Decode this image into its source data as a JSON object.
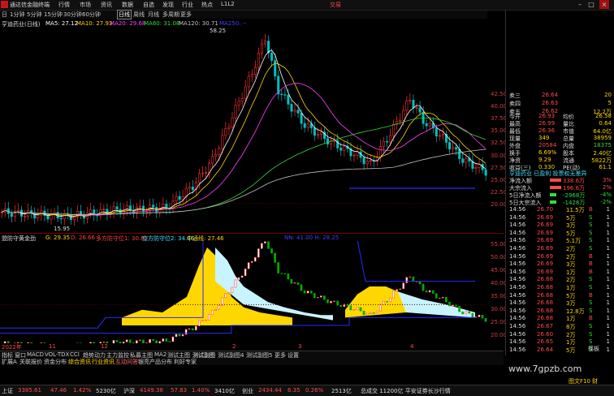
{
  "titlebar": {
    "app_title": "通达信金融终端",
    "menus": [
      "行情",
      "市场",
      "资讯",
      "数据",
      "自选",
      "发现",
      "行业",
      "热点",
      "L1L2"
    ],
    "trade_label": "交易"
  },
  "periods": [
    "日",
    "1分钟",
    "5分钟",
    "15分钟",
    "30分钟",
    "60分钟",
    "日线",
    "周线",
    "月线",
    "多周期",
    "更多"
  ],
  "selected_period": "日线",
  "main_chart": {
    "stock_title": "亨迪药业(日线)",
    "ma_legend": [
      {
        "label": "MA5: 27.12",
        "color": "#ffffff"
      },
      {
        "label": "MA10: 27.93",
        "color": "#ffd700"
      },
      {
        "label": "MA20: 29.68",
        "color": "#ff40ff"
      },
      {
        "label": "MA60: 31.08",
        "color": "#33dd33"
      },
      {
        "label": "MA120: 30.71",
        "color": "#c0c0c0"
      },
      {
        "label": "MA250: --",
        "color": "#4040ff"
      }
    ],
    "high_label": "58.25",
    "low_label": "15.95",
    "y_labels": [
      "42.50",
      "40.00",
      "37.50",
      "35.00",
      "32.50",
      "30.00",
      "27.50",
      "25.00",
      "22.50",
      "20.00"
    ]
  },
  "sub_chart": {
    "indicator_title": "盟防守黄金劲",
    "legend": [
      {
        "label": "G: 29.35",
        "color": "#ffd700"
      },
      {
        "label": "D: 26.66",
        "color": "#ff4040"
      },
      {
        "label": "多方防守位1: 30.85",
        "color": "#ff4040"
      },
      {
        "label": "空方防守位2: 34.66",
        "color": "#40e0ff"
      },
      {
        "label": "中通线: 27.46",
        "color": "#ffd700"
      },
      {
        "label": "NN: 41.00 H: 28.25",
        "color": "#4040ff"
      }
    ],
    "y_labels": [
      "55.00",
      "50.00",
      "45.00",
      "40.00",
      "35.00",
      "30.00",
      "25.00",
      "20.00"
    ]
  },
  "chart_colors": {
    "up": "#ff3030",
    "down": "#00c0c0",
    "yellow_fill": "#ffd700",
    "cyan_fill": "#c8f4ff",
    "blue_line": "#2a2aff"
  },
  "quote_panel": {
    "asks": [
      {
        "label": "卖三",
        "price": "26.64",
        "vol": "20"
      },
      {
        "label": "卖四",
        "price": "26.63",
        "vol": "5"
      },
      {
        "label": "卖五",
        "price": "26.62",
        "vol": "12.2万"
      }
    ],
    "stats": [
      {
        "l1": "今开",
        "v1": "26.93",
        "l2": "均价",
        "v2": "26.58"
      },
      {
        "l1": "最高",
        "v1": "26.99",
        "l2": "量比",
        "v2": "0.64"
      },
      {
        "l1": "最低",
        "v1": "26.36",
        "l2": "市值",
        "v2": "64.0亿"
      },
      {
        "l1": "现量",
        "v1": "349",
        "l2": "总量",
        "v2": "38959"
      },
      {
        "l1": "外盘",
        "v1": "20584",
        "l2": "内盘",
        "v2": "18375"
      },
      {
        "l1": "换手",
        "v1": "6.69%",
        "l2": "股本",
        "v2": "2.40亿"
      },
      {
        "l1": "净资",
        "v1": "9.29",
        "l2": "流通",
        "v2": "5822万"
      },
      {
        "l1": "收益(三)",
        "v1": "0.330",
        "l2": "PE(动)",
        "v2": "61.1"
      }
    ],
    "status_line": "亨迪药业 已盈利 投票权无差异",
    "flows": [
      {
        "label": "净流入额",
        "value": "338.6万",
        "pct": "3%"
      },
      {
        "label": "大宗流入",
        "value": "196.6万",
        "pct": "2%"
      },
      {
        "label": "5日净流入额",
        "value": "-2968万",
        "pct": "-4%"
      },
      {
        "label": "5日大宗流入",
        "value": "-1428万",
        "pct": "-2%"
      }
    ],
    "ticks": [
      {
        "time": "14:56",
        "price": "26.70",
        "vol": "11.5万",
        "side": "B",
        "num": "1"
      },
      {
        "time": "14:56",
        "price": "26.69",
        "vol": "5万",
        "side": "S",
        "num": "1"
      },
      {
        "time": "14:56",
        "price": "26.69",
        "vol": "3万",
        "side": "S",
        "num": "1"
      },
      {
        "time": "14:56",
        "price": "26.69",
        "vol": "5万",
        "side": "S",
        "num": "1"
      },
      {
        "time": "14:56",
        "price": "26.69",
        "vol": "5.1万",
        "side": "S",
        "num": "1"
      },
      {
        "time": "14:56",
        "price": "26.69",
        "vol": "2万",
        "side": "S",
        "num": "1"
      },
      {
        "time": "14:56",
        "price": "26.69",
        "vol": "2万",
        "side": "B",
        "num": "1"
      },
      {
        "time": "14:56",
        "price": "26.69",
        "vol": "3万",
        "side": "B",
        "num": "1"
      },
      {
        "time": "14:56",
        "price": "26.69",
        "vol": "1万",
        "side": "B",
        "num": "1"
      },
      {
        "time": "14:56",
        "price": "26.68",
        "vol": "2万",
        "side": "S",
        "num": "1"
      },
      {
        "time": "14:56",
        "price": "26.68",
        "vol": "1万",
        "side": "S",
        "num": "1"
      },
      {
        "time": "14:56",
        "price": "26.68",
        "vol": "5万",
        "side": "B",
        "num": "1"
      },
      {
        "time": "14:56",
        "price": "26.68",
        "vol": "3万",
        "side": "S",
        "num": "1"
      },
      {
        "time": "14:56",
        "price": "26.68",
        "vol": "12.8万",
        "side": "S",
        "num": "1"
      },
      {
        "time": "14:56",
        "price": "26.68",
        "vol": "1万",
        "side": "B",
        "num": "1"
      },
      {
        "time": "14:56",
        "price": "26.67",
        "vol": "8万",
        "side": "S",
        "num": "1"
      },
      {
        "time": "14:56",
        "price": "26.60",
        "vol": "2万",
        "side": "S",
        "num": "1"
      },
      {
        "time": "14:56",
        "price": "26.65",
        "vol": "1万",
        "side": "S",
        "num": "1"
      },
      {
        "time": "14:56",
        "price": "26.64",
        "vol": "5万",
        "side": "S",
        "num": "1"
      }
    ]
  },
  "xaxis": {
    "labels": [
      "2022年",
      "11",
      "12",
      "2",
      "3",
      "4"
    ]
  },
  "indicator_tabs": [
    "指标",
    "窗口",
    "MACD",
    "VOL-TDX",
    "CCI",
    "趋势动力",
    "主力监控",
    "私募主图",
    "MA2",
    "测试主图",
    "测试副图",
    "测试副图4",
    "测试副图5",
    "更多",
    "设置"
  ],
  "info_tabs": [
    "扩展A",
    "关联报价",
    "资金分布",
    "综合资讯",
    "行业资讯",
    "互动问答",
    "银亮产品分布",
    "利好专家"
  ],
  "right_tab": "筷板",
  "statusbar": [
    {
      "label": "上证",
      "value": "3385.61",
      "chg": "47.46",
      "pct": "1.42%",
      "amt": "5230亿"
    },
    {
      "label": "沪深",
      "value": "4149.38",
      "chg": "57.83",
      "pct": "1.40%",
      "amt": "3410亿"
    },
    {
      "label": "创业",
      "value": "2434.44",
      "chg": "6.35",
      "pct": "0.26%",
      "amt": "2513亿"
    }
  ],
  "status_extra": "总成交 11200亿 平安证券长沙行情",
  "watermark": "www.7gpzb.com",
  "corner_label": "图文F10 财"
}
